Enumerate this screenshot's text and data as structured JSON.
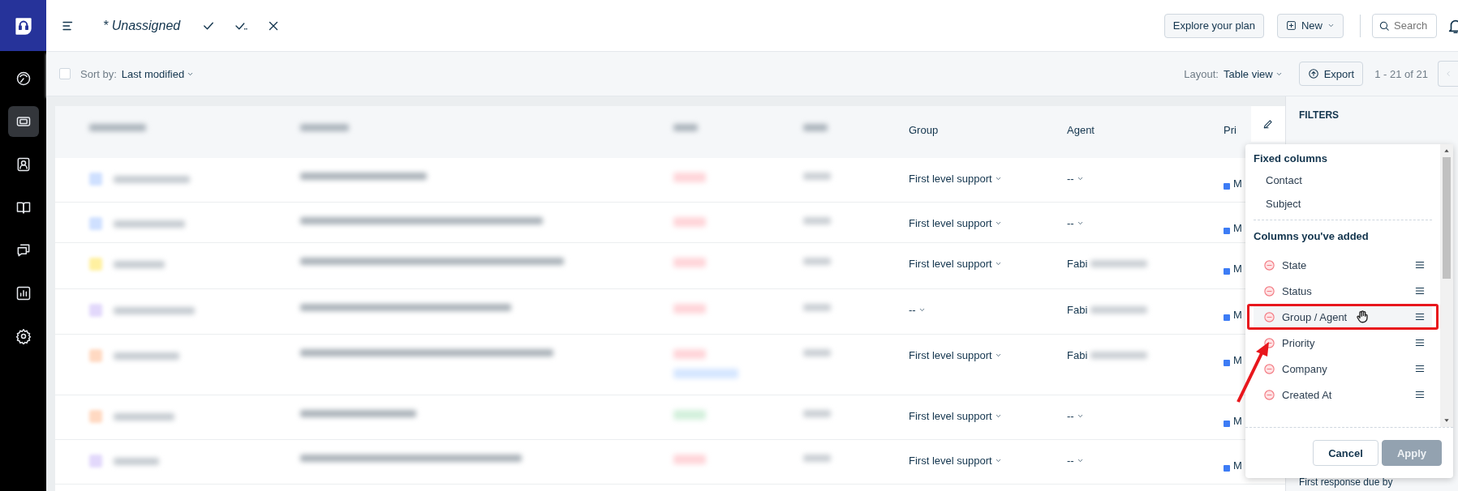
{
  "sidebar": {
    "items": [
      {
        "kind": "dashboard",
        "selected": false
      },
      {
        "kind": "tickets",
        "selected": true
      },
      {
        "kind": "contacts",
        "selected": false
      },
      {
        "kind": "knowledge",
        "selected": false
      },
      {
        "kind": "conversations",
        "selected": false
      },
      {
        "kind": "reports",
        "selected": false
      },
      {
        "kind": "settings",
        "selected": false
      }
    ]
  },
  "top_bar": {
    "title": "* Unassigned",
    "buttons": [
      "Explore your plan",
      "New"
    ],
    "search": {
      "placeholder": "Search"
    }
  },
  "toolbar": {
    "select_all": {
      "checked": false
    },
    "sort_label": "Sort by:",
    "sort_value": "Last modified",
    "layout_label": "Layout:",
    "layout_value": "Table view",
    "export": "Export",
    "pagination": "1 - 21 of 21"
  },
  "table": {
    "columns": [
      "Group",
      "Agent",
      "Pri"
    ],
    "rows": [
      {
        "group": "First level support",
        "agent": "--",
        "priority": "M"
      },
      {
        "group": "First level support",
        "agent": "--",
        "priority": "M"
      },
      {
        "group": "First level support",
        "agent": "Fabi",
        "priority": "M"
      },
      {
        "group": "--",
        "agent": "Fabi",
        "priority": "M"
      },
      {
        "group": "First level support",
        "agent": "Fabi",
        "priority": "M"
      },
      {
        "group": "First level support",
        "agent": "--",
        "priority": "M"
      },
      {
        "group": "First level support",
        "agent": "--",
        "priority": "M"
      }
    ]
  },
  "filters": {
    "title": "FILTERS",
    "footer_label": "First response due by"
  },
  "column_popup": {
    "fixed_title": "Fixed columns",
    "fixed": [
      "Contact",
      "Subject"
    ],
    "added_title": "Columns you've added",
    "added": [
      {
        "label": "State",
        "highlighted": false
      },
      {
        "label": "Status",
        "highlighted": false
      },
      {
        "label": "Group / Agent",
        "highlighted": true
      },
      {
        "label": "Priority",
        "highlighted": false
      },
      {
        "label": "Company",
        "highlighted": false
      },
      {
        "label": "Created At",
        "highlighted": false
      }
    ],
    "buttons": [
      {
        "label": "Cancel",
        "disabled": false
      },
      {
        "label": "Apply",
        "disabled": true
      }
    ]
  }
}
